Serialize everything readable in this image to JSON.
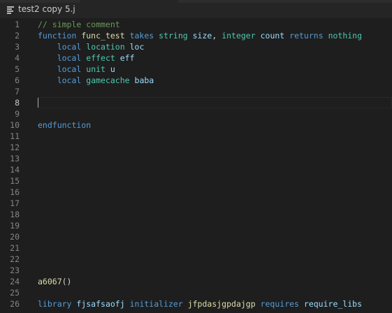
{
  "tab": {
    "title": "test2 copy 5.j",
    "icon": "file-lines-icon"
  },
  "editor": {
    "active_line": 8,
    "line_numbers": [
      "1",
      "2",
      "3",
      "4",
      "5",
      "6",
      "7",
      "8",
      "9",
      "10",
      "11",
      "12",
      "13",
      "14",
      "15",
      "16",
      "17",
      "18",
      "19",
      "20",
      "21",
      "22",
      "23",
      "24",
      "25",
      "26"
    ],
    "lines": [
      [
        {
          "t": "// simple comment",
          "c": "cm"
        }
      ],
      [
        {
          "t": "function",
          "c": "kw"
        },
        {
          "t": " ",
          "c": "tx"
        },
        {
          "t": "func_test",
          "c": "fn"
        },
        {
          "t": " ",
          "c": "tx"
        },
        {
          "t": "takes",
          "c": "kw"
        },
        {
          "t": " ",
          "c": "tx"
        },
        {
          "t": "string",
          "c": "ty"
        },
        {
          "t": " ",
          "c": "tx"
        },
        {
          "t": "size",
          "c": "id"
        },
        {
          "t": ", ",
          "c": "tx"
        },
        {
          "t": "integer",
          "c": "ty"
        },
        {
          "t": " ",
          "c": "tx"
        },
        {
          "t": "count",
          "c": "id"
        },
        {
          "t": " ",
          "c": "tx"
        },
        {
          "t": "returns",
          "c": "kw"
        },
        {
          "t": " ",
          "c": "tx"
        },
        {
          "t": "nothing",
          "c": "ty"
        }
      ],
      [
        {
          "t": "    ",
          "c": "tx"
        },
        {
          "t": "local",
          "c": "kw"
        },
        {
          "t": " ",
          "c": "tx"
        },
        {
          "t": "location",
          "c": "ty"
        },
        {
          "t": " ",
          "c": "tx"
        },
        {
          "t": "loc",
          "c": "id"
        }
      ],
      [
        {
          "t": "    ",
          "c": "tx"
        },
        {
          "t": "local",
          "c": "kw"
        },
        {
          "t": " ",
          "c": "tx"
        },
        {
          "t": "effect",
          "c": "ty"
        },
        {
          "t": " ",
          "c": "tx"
        },
        {
          "t": "eff",
          "c": "id"
        }
      ],
      [
        {
          "t": "    ",
          "c": "tx"
        },
        {
          "t": "local",
          "c": "kw"
        },
        {
          "t": " ",
          "c": "tx"
        },
        {
          "t": "unit",
          "c": "ty"
        },
        {
          "t": " ",
          "c": "tx"
        },
        {
          "t": "u",
          "c": "id"
        }
      ],
      [
        {
          "t": "    ",
          "c": "tx"
        },
        {
          "t": "local",
          "c": "kw"
        },
        {
          "t": " ",
          "c": "tx"
        },
        {
          "t": "gamecache",
          "c": "ty"
        },
        {
          "t": " ",
          "c": "tx"
        },
        {
          "t": "baba",
          "c": "id"
        }
      ],
      [],
      [],
      [],
      [
        {
          "t": "endfunction",
          "c": "kw"
        }
      ],
      [],
      [],
      [],
      [],
      [],
      [],
      [],
      [],
      [],
      [],
      [],
      [],
      [],
      [
        {
          "t": "a6067",
          "c": "fn"
        },
        {
          "t": "()",
          "c": "tx"
        }
      ],
      [],
      [
        {
          "t": "library",
          "c": "kw"
        },
        {
          "t": " ",
          "c": "tx"
        },
        {
          "t": "fjsafsaofj",
          "c": "id"
        },
        {
          "t": " ",
          "c": "tx"
        },
        {
          "t": "initializer",
          "c": "kw"
        },
        {
          "t": " ",
          "c": "tx"
        },
        {
          "t": "jfpdasjgpdajgp",
          "c": "fn"
        },
        {
          "t": " ",
          "c": "tx"
        },
        {
          "t": "requires",
          "c": "kw"
        },
        {
          "t": " ",
          "c": "tx"
        },
        {
          "t": "require_libs",
          "c": "id"
        }
      ]
    ]
  },
  "colors": {
    "background": "#1e1e1e",
    "keyword": "#569cd6",
    "type": "#4ec9b0",
    "identifier": "#9cdcfe",
    "function": "#dcdcaa",
    "comment": "#6a9955",
    "line_number": "#858585"
  }
}
